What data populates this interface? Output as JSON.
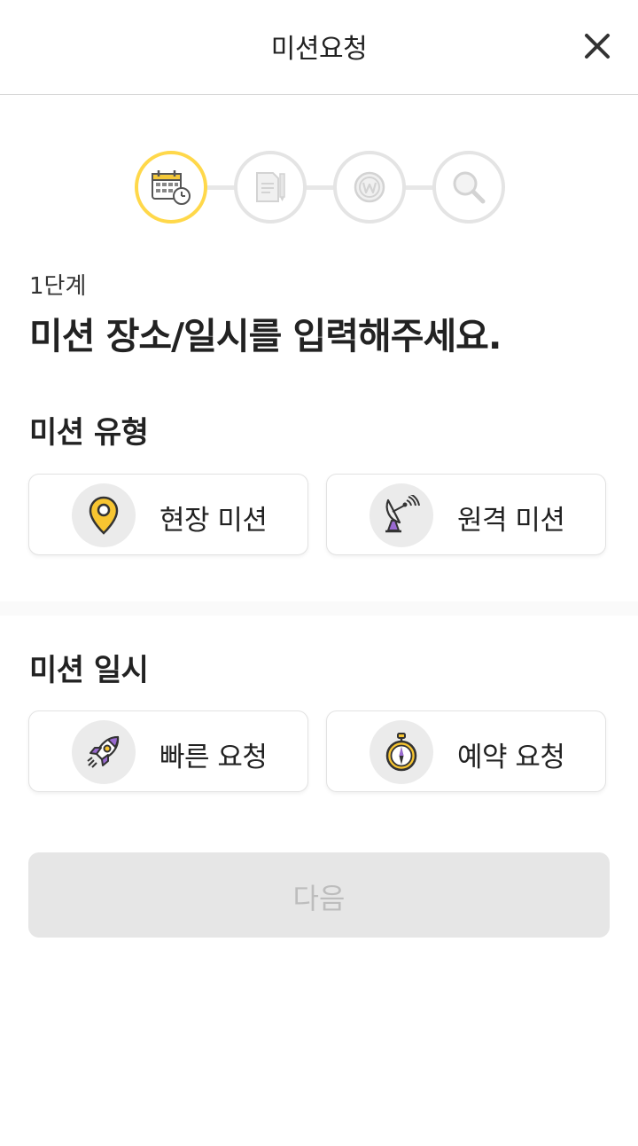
{
  "header": {
    "title": "미션요청",
    "close_icon": "close-icon"
  },
  "stepper": {
    "current_step": 1,
    "total_steps": 4,
    "active_color": "#ffd84a",
    "steps": [
      {
        "icon": "calendar-clock-icon",
        "active": true
      },
      {
        "icon": "document-pencil-icon",
        "active": false
      },
      {
        "icon": "coin-icon",
        "active": false
      },
      {
        "icon": "magnifier-icon",
        "active": false
      }
    ]
  },
  "step_label": "1단계",
  "headline": "미션 장소/일시를 입력해주세요.",
  "mission_type": {
    "title": "미션 유형",
    "options": [
      {
        "label": "현장 미션",
        "icon": "location-pin-icon"
      },
      {
        "label": "원격 미션",
        "icon": "satellite-dish-icon"
      }
    ]
  },
  "mission_time": {
    "title": "미션 일시",
    "options": [
      {
        "label": "빠른 요청",
        "icon": "rocket-icon"
      },
      {
        "label": "예약 요청",
        "icon": "stopwatch-icon"
      }
    ]
  },
  "next_button": {
    "label": "다음",
    "enabled": false
  }
}
